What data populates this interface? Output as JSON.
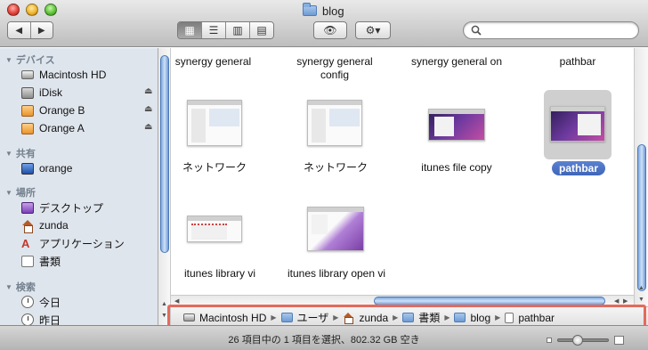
{
  "window": {
    "title": "blog"
  },
  "toolbar": {
    "back_icon": "◀",
    "forward_icon": "▶",
    "view_icons": [
      "▦",
      "☰",
      "▥",
      "▤"
    ],
    "quicklook_icon": "👁",
    "action_icon": "⚙▾",
    "search_placeholder": ""
  },
  "sidebar": {
    "sections": [
      {
        "title": "デバイス",
        "items": [
          {
            "label": "Macintosh HD",
            "icon": "hd-icon",
            "eject": false
          },
          {
            "label": "iDisk",
            "icon": "idisk-icon",
            "eject": true
          },
          {
            "label": "Orange B",
            "icon": "disk-icon",
            "eject": true
          },
          {
            "label": "Orange A",
            "icon": "disk-icon",
            "eject": true
          }
        ]
      },
      {
        "title": "共有",
        "items": [
          {
            "label": "orange",
            "icon": "screen-icon"
          }
        ]
      },
      {
        "title": "場所",
        "items": [
          {
            "label": "デスクトップ",
            "icon": "desktop-icon"
          },
          {
            "label": "zunda",
            "icon": "home-icon"
          },
          {
            "label": "アプリケーション",
            "icon": "applications-icon"
          },
          {
            "label": "書類",
            "icon": "document-icon"
          }
        ]
      },
      {
        "title": "検索",
        "items": [
          {
            "label": "今日",
            "icon": "clock-icon"
          },
          {
            "label": "昨日",
            "icon": "clock-icon"
          }
        ]
      }
    ],
    "eject_glyph": "⏏"
  },
  "files": [
    {
      "name": "synergy general",
      "selected": false
    },
    {
      "name": "synergy general config",
      "selected": false
    },
    {
      "name": "synergy general on",
      "selected": false
    },
    {
      "name": "pathbar",
      "selected": false
    },
    {
      "name": "ネットワーク",
      "selected": false
    },
    {
      "name": "ネットワーク",
      "selected": false
    },
    {
      "name": "itunes file copy",
      "selected": false
    },
    {
      "name": "pathbar",
      "selected": true
    },
    {
      "name": "itunes library vi",
      "selected": false
    },
    {
      "name": "itunes library open vi",
      "selected": false
    }
  ],
  "path_bar": [
    "Macintosh HD",
    "ユーザ",
    "zunda",
    "書類",
    "blog",
    "pathbar"
  ],
  "path_sep": "▶",
  "status": {
    "text": "26 項目中の 1 項目を選択、802.32 GB 空き"
  },
  "colors": {
    "selection": "#3f66b8",
    "highlight": "#e36b5c",
    "sidebar_bg": "#dfe5ed"
  }
}
